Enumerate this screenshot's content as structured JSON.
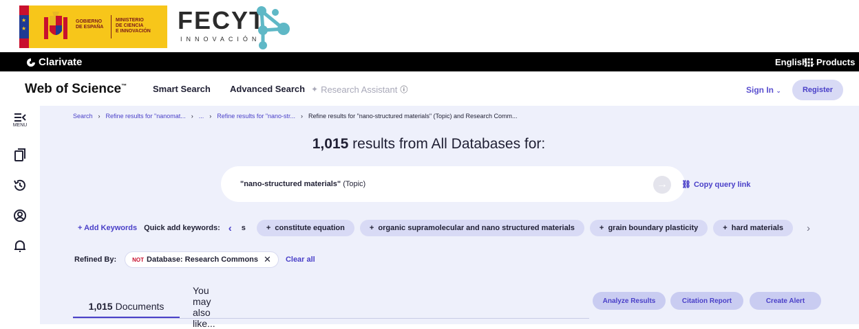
{
  "logos": {
    "gob_line1": "GOBIERNO",
    "gob_line2": "DE ESPAÑA",
    "min_line1": "MINISTERIO",
    "min_line2": "DE CIENCIA",
    "min_line3": "E INNOVACIÓN",
    "fecyt_word": "FECYT",
    "fecyt_sub": "INNOVACIÓN"
  },
  "clarivate": {
    "brand": "Clarivate",
    "language": "English",
    "products": "Products"
  },
  "header": {
    "logo": "Web of Science",
    "smart_search": "Smart Search",
    "advanced_search": "Advanced Search",
    "research_assistant": "Research Assistant",
    "sign_in": "Sign In",
    "register": "Register"
  },
  "rail": {
    "menu_label": "MENU"
  },
  "breadcrumbs": [
    "Search",
    "Refine results for \"nanomat...",
    "...",
    "Refine results for \"nano-str...",
    "Refine results for \"nano-structured materials\" (Topic) and Research Comm..."
  ],
  "results": {
    "count": "1,015",
    "text": "results from All Databases for:"
  },
  "query": {
    "term": "\"nano-structured materials\"",
    "field": "(Topic)",
    "copy_link": "Copy query link"
  },
  "keywords": {
    "add_label": "Add Keywords",
    "quick_label": "Quick add keywords:",
    "partial": "s",
    "chips": [
      "constitute equation",
      "organic supramolecular and nano structured materials",
      "grain boundary plasticity",
      "hard materials"
    ]
  },
  "refined": {
    "label": "Refined By:",
    "not": "NOT",
    "filter": "Database: Research Commons",
    "clear_all": "Clear all"
  },
  "tabs": {
    "documents_count": "1,015",
    "documents_label": "Documents",
    "also_like": "You may also like..."
  },
  "actions": {
    "analyze": "Analyze Results",
    "citation": "Citation Report",
    "alert": "Create Alert"
  },
  "colors": {
    "accent": "#4a40c8",
    "chip_bg": "#d8daf5",
    "main_bg": "#eef0fb",
    "gob_yellow": "#f7c61a",
    "fecyt_teal": "#5fb8c6"
  }
}
